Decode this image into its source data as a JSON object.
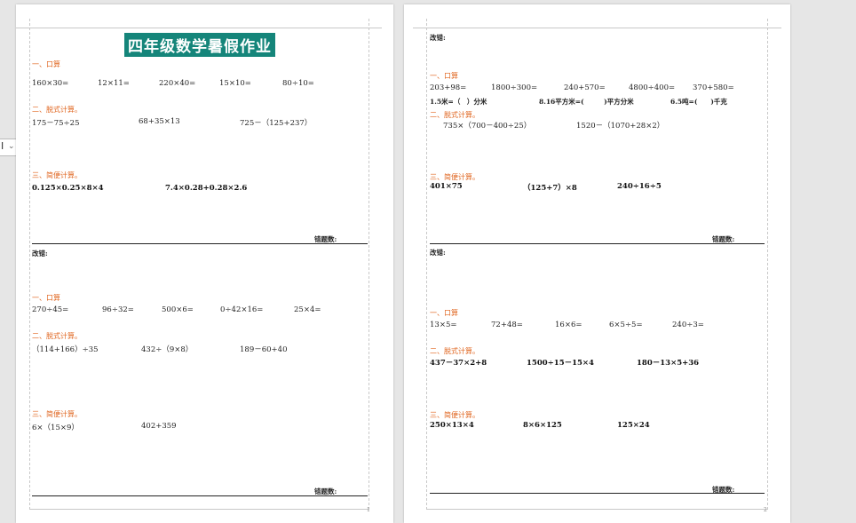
{
  "page1": {
    "title": "四年级数学暑假作业",
    "s1_label": "一、口算",
    "s1_items": [
      "160×30=",
      "12×11=",
      "220×40=",
      "15×10=",
      "80÷10="
    ],
    "s2_label": "二、脱式计算。",
    "s2_items": [
      "175－75÷25",
      "68+35×13",
      "725－（125+237）"
    ],
    "s3_label": "三、简便计算。",
    "s3_items": [
      "0.125×0.25×8×4",
      "7.4×0.28+0.28×2.6"
    ],
    "score1": "错题数:",
    "correct": "改错:",
    "s4_label": "一、口算",
    "s4_items": [
      "270÷45=",
      "96÷32=",
      "500×6=",
      "0÷42×16=",
      "25×4="
    ],
    "s5_label": "二、脱式计算。",
    "s5_items": [
      "（114+166）÷35",
      "432÷（9×8）",
      "189－60+40"
    ],
    "s6_label": "三、简便计算。",
    "s6_items": [
      "6×（15×9）",
      "402+359"
    ],
    "score2": "错题数:",
    "page_num": "1"
  },
  "page2": {
    "correct1": "改错:",
    "s1_label": "一、口算",
    "s1_items": [
      "203+98=",
      "1800÷300=",
      "240+570=",
      "4800÷400=",
      "370+580="
    ],
    "units": [
      "1.5米=（　）分米",
      "8.16平方米=(　　　)平方分米",
      "6.5吨=(　　)千克"
    ],
    "s2_label": "二、脱式计算。",
    "s2_items": [
      "735×（700－400÷25）",
      "1520－（1070+28×2）"
    ],
    "s3_label": "三、简便计算。",
    "s3_items": [
      "401×75",
      "（125+7）×8",
      "240÷16÷5"
    ],
    "score1": "错题数:",
    "correct2": "改错:",
    "s4_label": "一、口算",
    "s4_items": [
      "13×5=",
      "72+48=",
      "16×6=",
      "6×5÷5=",
      "240÷3="
    ],
    "s5_label": "二、脱式计算。",
    "s5_items": [
      "437－37×2+8",
      "1500÷15－15×4",
      "180－13×5+36"
    ],
    "s6_label": "三、简便计算。",
    "s6_items": [
      "250×13×4",
      "8×6×125",
      "125×24"
    ],
    "score2": "错题数:",
    "page_num": "2"
  }
}
